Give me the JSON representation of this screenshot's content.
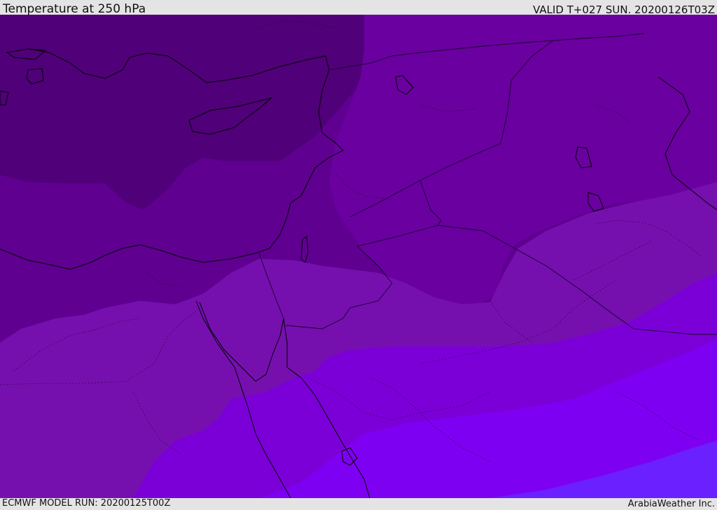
{
  "header": {
    "title": "Temperature at 250 hPa",
    "valid_time": "VALID T+027 SUN. 20200126T03Z"
  },
  "footer": {
    "model_run": "ECMWF MODEL RUN: 20200125T00Z",
    "credit": "ArabiaWeather Inc."
  },
  "map": {
    "field": "temperature",
    "level": "250 hPa",
    "bands": [
      {
        "name": "band-1",
        "color": "#500078"
      },
      {
        "name": "band-2",
        "color": "#5f0090"
      },
      {
        "name": "band-3",
        "color": "#6a009f"
      },
      {
        "name": "band-4",
        "color": "#7510ae"
      },
      {
        "name": "band-5",
        "color": "#7b00d7"
      },
      {
        "name": "band-6",
        "color": "#7e00f2"
      },
      {
        "name": "band-7",
        "color": "#6a20ff"
      }
    ],
    "coastline_color": "#000000",
    "border_color": "#1a0030"
  }
}
